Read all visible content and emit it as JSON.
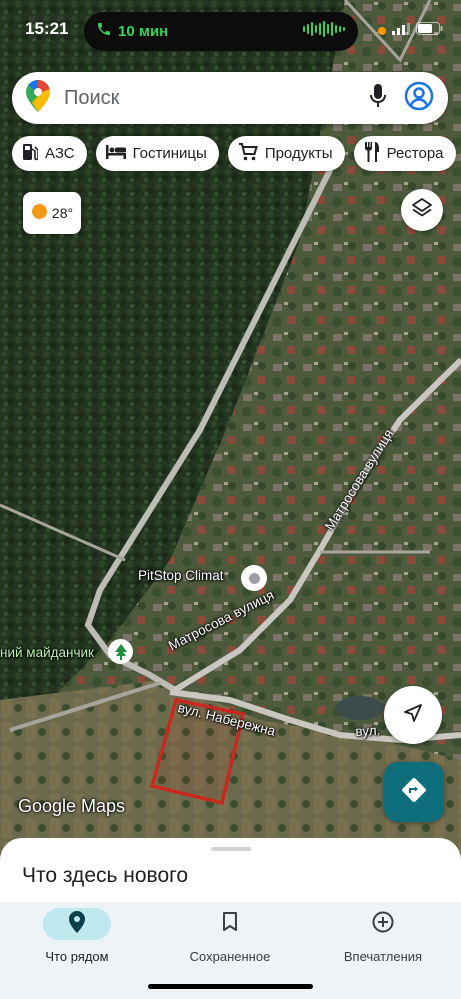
{
  "status_bar": {
    "time": "15:21",
    "call_duration": "10 мин"
  },
  "search": {
    "placeholder": "Поиск"
  },
  "chips": [
    {
      "label": "АЗС",
      "icon": "gas-station-icon"
    },
    {
      "label": "Гостиницы",
      "icon": "hotel-bed-icon"
    },
    {
      "label": "Продукты",
      "icon": "shopping-cart-icon"
    },
    {
      "label": "Рестора",
      "icon": "restaurant-icon"
    }
  ],
  "weather": {
    "temperature": "28°"
  },
  "map": {
    "poi_name": "PitStop Climat",
    "park_label": "ний майданчик",
    "street_1": "Матросова вулиця",
    "street_2": "Матросова вулиця",
    "street_3": "вул. Набережна",
    "street_4": "вул.",
    "logo": "Google Maps"
  },
  "sheet": {
    "title": "Что здесь нового"
  },
  "nav": [
    {
      "label": "Что рядом",
      "icon": "location-pin-icon"
    },
    {
      "label": "Сохраненное",
      "icon": "bookmark-icon"
    },
    {
      "label": "Впечатления",
      "icon": "add-circle-icon"
    }
  ],
  "colors": {
    "accent": "#1a73e8",
    "directions_button": "#0e6e7c",
    "active_nav": "#bfe8ef",
    "call_green": "#3ad35a",
    "plot_outline": "#c8281e"
  }
}
